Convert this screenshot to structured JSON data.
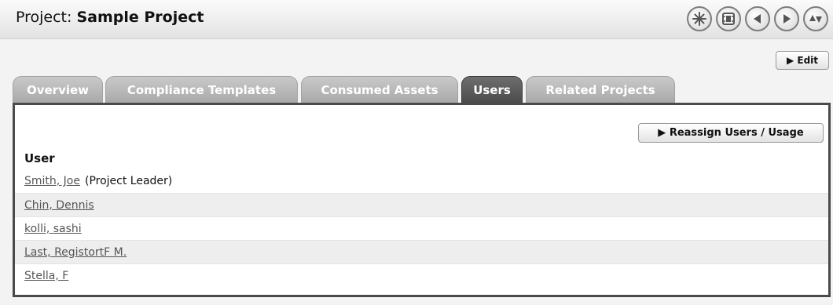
{
  "header": {
    "title_prefix": "Project:",
    "project_name": "Sample Project",
    "controls": [
      {
        "icon": "asterisk-icon",
        "label": ""
      },
      {
        "icon": "film-icon",
        "label": ""
      },
      {
        "icon": "back-arrow-icon",
        "label": ""
      },
      {
        "icon": "forward-arrow-icon",
        "label": ""
      },
      {
        "icon": "up-down-arrows-icon",
        "label": ""
      }
    ]
  },
  "actions": {
    "edit_label": "▶ Edit"
  },
  "tabs": [
    {
      "label": "Overview",
      "active": false
    },
    {
      "label": "Compliance Templates",
      "active": false
    },
    {
      "label": "Consumed Assets",
      "active": false
    },
    {
      "label": "Users",
      "active": true
    },
    {
      "label": "Related Projects",
      "active": false
    }
  ],
  "users_panel": {
    "reassign_label": "▶ Reassign Users / Usage",
    "column_header": "User",
    "rows": [
      {
        "name": "Smith, Joe",
        "role": "(Project Leader)"
      },
      {
        "name": "Chin, Dennis",
        "role": ""
      },
      {
        "name": "kolli, sashi",
        "role": ""
      },
      {
        "name": "Last, RegistortF M.",
        "role": ""
      },
      {
        "name": "Stella, F",
        "role": ""
      }
    ]
  },
  "colors": {
    "header_bg": "#e8e8e8",
    "tab_inactive": "#b5b5b5",
    "tab_active": "#5a5a5a",
    "panel_border": "#4a4a4a",
    "link": "#555555",
    "row_stripe": "#eeeeee"
  }
}
